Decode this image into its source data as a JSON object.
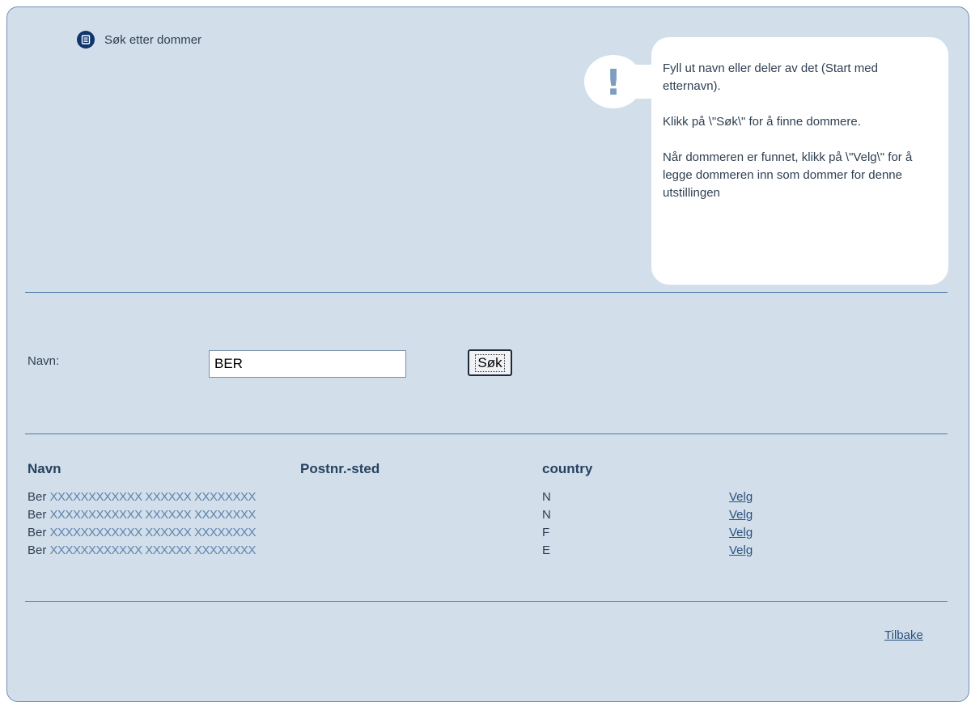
{
  "header": {
    "title": "Søk etter dommer",
    "icon": "document-icon"
  },
  "hint": {
    "icon": "exclamation-icon",
    "paragraphs": [
      "Fyll ut navn eller deler av det (Start med etternavn).",
      "Klikk på \\\"Søk\\\" for å finne dommere.",
      "Når dommeren er funnet, klikk på \\\"Velg\\\" for å legge dommeren inn som dommer for denne utstillingen"
    ]
  },
  "search": {
    "label": "Navn:",
    "value": "BER",
    "button_label": "Søk"
  },
  "results": {
    "columns": {
      "name": "Navn",
      "place": "Postnr.-sted",
      "country": "country"
    },
    "rows": [
      {
        "prefix": "Ber",
        "masked": "XXXXXXXXXXXX XXXXXX XXXXXXXX",
        "country": "N",
        "action": "Velg"
      },
      {
        "prefix": "Ber",
        "masked": "XXXXXXXXXXXX XXXXXX XXXXXXXX",
        "country": "N",
        "action": "Velg"
      },
      {
        "prefix": "Ber",
        "masked": "XXXXXXXXXXXX XXXXXX XXXXXXXX",
        "country": "F",
        "action": "Velg"
      },
      {
        "prefix": "Ber",
        "masked": "XXXXXXXXXXXX XXXXXX XXXXXXXX",
        "country": "E",
        "action": "Velg"
      }
    ]
  },
  "footer": {
    "back_label": "Tilbake"
  },
  "colors": {
    "panel_bg": "#d2dfeb",
    "border": "#6e8fb4",
    "link": "#2b4f7e",
    "icon_dark": "#10356b"
  }
}
